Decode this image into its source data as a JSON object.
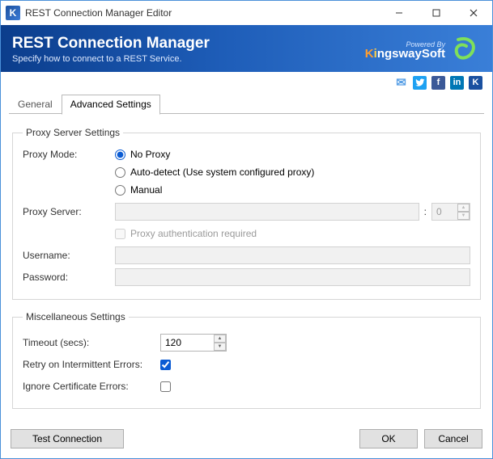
{
  "window": {
    "title": "REST Connection Manager Editor",
    "app_icon_letter": "K"
  },
  "header": {
    "title": "REST Connection Manager",
    "subtitle": "Specify how to connect to a REST Service.",
    "powered_by": "Powered By",
    "brand_prefix": "K",
    "brand_mid": "i",
    "brand_rest": "ngswaySoft"
  },
  "social": {
    "email": "✉",
    "twitter": "t",
    "facebook": "f",
    "linkedin": "in",
    "k": "K"
  },
  "tabs": {
    "general": "General",
    "advanced": "Advanced Settings"
  },
  "proxy": {
    "legend": "Proxy Server Settings",
    "mode_label": "Proxy Mode:",
    "opt_no_proxy": "No Proxy",
    "opt_autodetect": "Auto-detect (Use system configured proxy)",
    "opt_manual": "Manual",
    "server_label": "Proxy Server:",
    "server_value": "",
    "port_value": "0",
    "auth_required_label": "Proxy authentication required",
    "username_label": "Username:",
    "username_value": "",
    "password_label": "Password:",
    "password_value": ""
  },
  "misc": {
    "legend": "Miscellaneous Settings",
    "timeout_label": "Timeout (secs):",
    "timeout_value": "120",
    "retry_label": "Retry on Intermittent Errors:",
    "ignore_cert_label": "Ignore Certificate Errors:"
  },
  "buttons": {
    "test": "Test Connection",
    "ok": "OK",
    "cancel": "Cancel"
  }
}
